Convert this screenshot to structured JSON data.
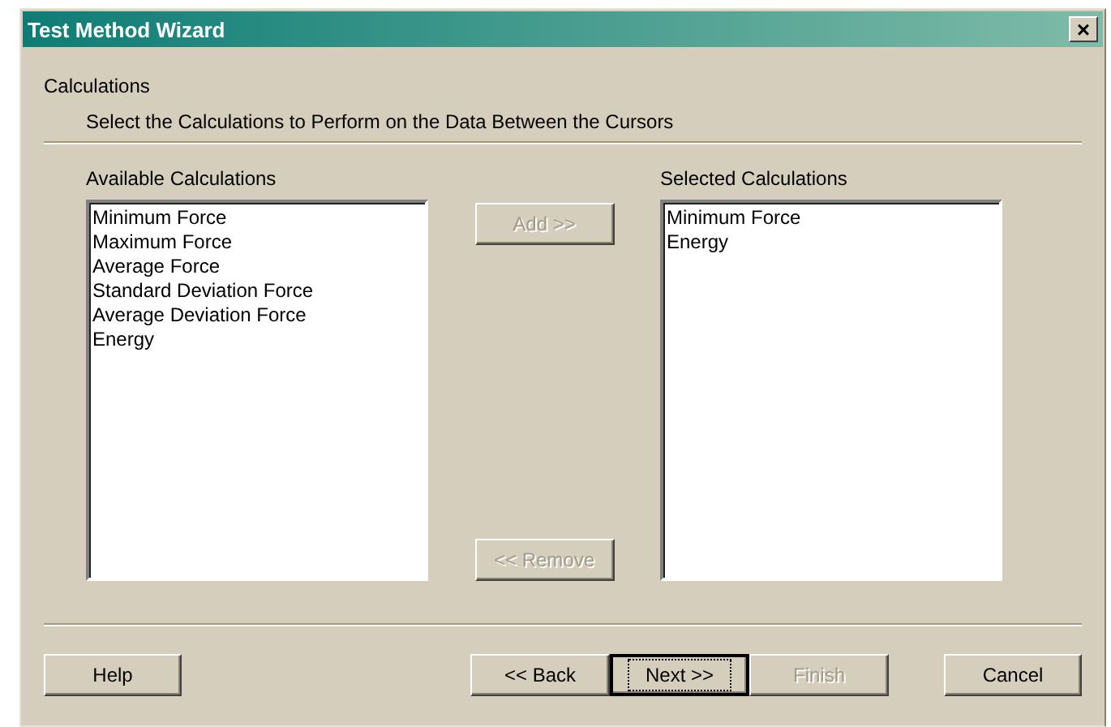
{
  "window": {
    "title": "Test Method Wizard",
    "close": "×"
  },
  "heading": "Calculations",
  "subheading": "Select the Calculations to Perform on the Data Between the Cursors",
  "available": {
    "label": "Available Calculations",
    "items": [
      "Minimum Force",
      "Maximum Force",
      "Average Force",
      "Standard Deviation Force",
      "Average Deviation Force",
      "Energy"
    ]
  },
  "move_buttons": [
    {
      "label": "Add >>",
      "disabled": true
    },
    {
      "label": "<< Remove",
      "disabled": true
    }
  ],
  "selected": {
    "label": "Selected Calculations",
    "items": [
      "Minimum Force",
      "Energy"
    ]
  },
  "help_button": {
    "label": "Help",
    "disabled": false
  },
  "nav_buttons": [
    {
      "label": "<< Back",
      "disabled": false,
      "focused": false
    },
    {
      "label": "Next >>",
      "disabled": false,
      "focused": true
    },
    {
      "label": "Finish",
      "disabled": true,
      "focused": false
    }
  ],
  "cancel_button": {
    "label": "Cancel",
    "disabled": false
  }
}
